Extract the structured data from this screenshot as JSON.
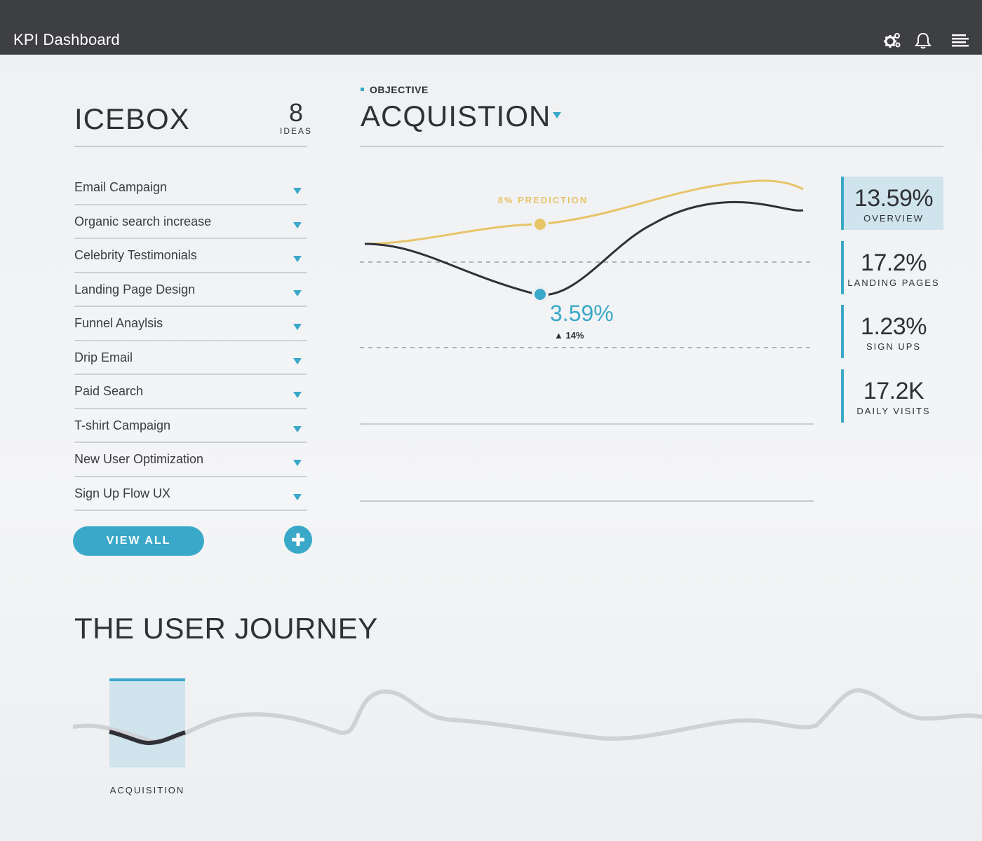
{
  "header": {
    "title": "KPI Dashboard",
    "icons": [
      "gears-icon",
      "bell-icon",
      "menu-icon"
    ]
  },
  "icebox": {
    "title": "ICEBOX",
    "count": "8",
    "count_label": "IDEAS",
    "items": [
      {
        "label": "Email Campaign"
      },
      {
        "label": "Organic search increase"
      },
      {
        "label": "Celebrity Testimonials"
      },
      {
        "label": "Landing Page Design"
      },
      {
        "label": "Funnel Anaylsis"
      },
      {
        "label": "Drip Email"
      },
      {
        "label": "Paid Search"
      },
      {
        "label": "T-shirt Campaign"
      },
      {
        "label": "New User Optimization"
      },
      {
        "label": "Sign Up Flow UX"
      }
    ],
    "view_all_label": "VIEW ALL"
  },
  "objective": {
    "label": "OBJECTIVE",
    "title": "ACQUISTION"
  },
  "chart": {
    "prediction_label": "8% PREDICTION",
    "current_value": "3.59%",
    "change": "▲ 14%",
    "colors": {
      "prediction": "#e8c468",
      "actual": "#2f3136",
      "accent": "#3aa8c8"
    }
  },
  "kpis": [
    {
      "value": "13.59%",
      "label": "OVERVIEW",
      "active": true
    },
    {
      "value": "17.2%",
      "label": "LANDING PAGES"
    },
    {
      "value": "1.23%",
      "label": "SIGN UPS"
    },
    {
      "value": "17.2K",
      "label": "DAILY VISITS"
    }
  ],
  "journey": {
    "title": "THE USER JOURNEY",
    "stage_label": "ACQUISITION"
  }
}
